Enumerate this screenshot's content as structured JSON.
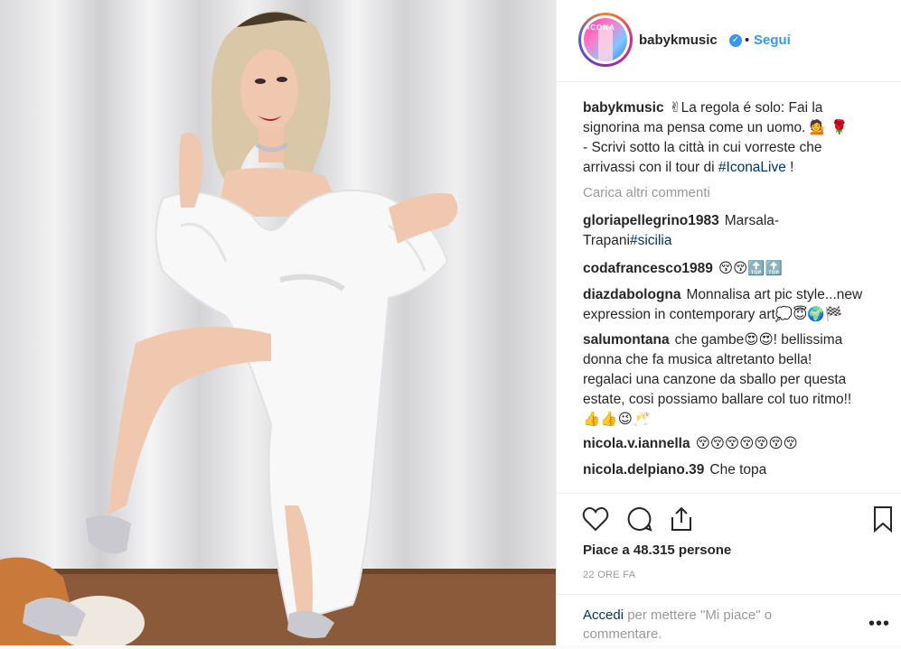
{
  "post": {
    "username": "babykmusic",
    "follow_label": "Segui",
    "separator": "•",
    "avatar_text": "ICONA",
    "caption": {
      "username": "babykmusic",
      "line1": "✌La regola é solo: Fai la",
      "line2": "signorina ma pensa come un uomo. 💁 🌹",
      "line3": "- Scrivi sotto la città in cui vorreste che",
      "line4_text": "arrivassi con il tour di ",
      "line4_tag": "#IconaLive",
      "line4_end": " !"
    },
    "load_more": "Carica altri commenti",
    "comments": [
      {
        "user": "gloriapellegrino1983",
        "text": "Marsala-",
        "text2": "Trapani",
        "tag": "#sicilia"
      },
      {
        "user": "codafrancesco1989",
        "text": "😚😚🔝🔝"
      },
      {
        "user": "diazdabologna",
        "text": "Monnalisa art pic style...new",
        "text2": "expression in contemporary art💭😇🌍🏁"
      },
      {
        "user": "salumontana",
        "text": "che gambe😍😍! bellissima",
        "text2": "donna che fa musica altretanto bella!",
        "text3": "regalaci una canzone da sballo per questa",
        "text4": "estate, cosi possiamo ballare col tuo ritmo!!",
        "text5": "👍👍😉🥂"
      },
      {
        "user": "nicola.v.iannella",
        "text": "😚😚😚😚😚😚😚"
      },
      {
        "user": "nicola.delpiano.39",
        "text": "Che topa"
      }
    ],
    "likes_label": "Piace a 48.315 persone",
    "time_label": "22 ORE FA",
    "login": {
      "link": "Accedi",
      "text": " per mettere \"Mi piace\" o commentare.",
      "more": "•••"
    }
  },
  "icons": {
    "like": "heart-icon",
    "comment": "comment-icon",
    "share": "share-icon",
    "save": "bookmark-icon"
  },
  "colors": {
    "link_blue": "#3897f0",
    "tag_blue": "#003569",
    "muted": "#999999"
  }
}
